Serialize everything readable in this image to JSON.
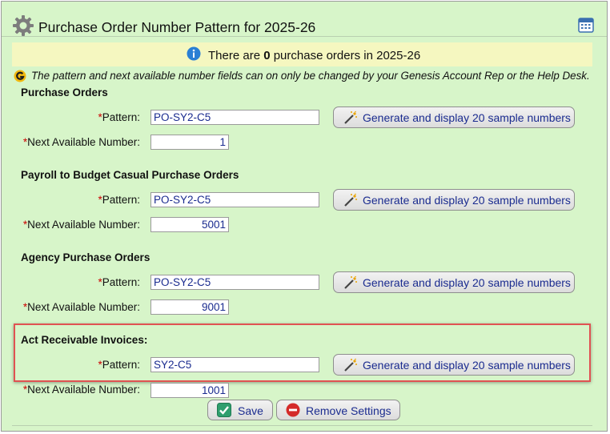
{
  "title": "Purchase Order Number Pattern for 2025-26",
  "banner": {
    "prefix": "There are ",
    "count": "0",
    "suffix": " purchase orders in 2025-26"
  },
  "notice": "The pattern and next available number fields can on only be changed by your Genesis Account Rep or the Help Desk.",
  "labels": {
    "required_mark": "*",
    "pattern": "Pattern:",
    "next_available": "Next Available Number:"
  },
  "generate_label": "Generate and display 20 sample numbers",
  "sections": [
    {
      "title": "Purchase Orders",
      "pattern": "PO-SY2-C5",
      "next": "1"
    },
    {
      "title": "Payroll to Budget Casual Purchase Orders",
      "pattern": "PO-SY2-C5",
      "next": "5001"
    },
    {
      "title": "Agency Purchase Orders",
      "pattern": "PO-SY2-C5",
      "next": "9001"
    },
    {
      "title": "Act Receivable Invoices:",
      "pattern": "SY2-C5",
      "next": "1001"
    }
  ],
  "actions": {
    "save": "Save",
    "remove": "Remove Settings"
  },
  "colors": {
    "panel_bg": "#d7f5c9",
    "banner_bg": "#f5f7c0",
    "highlight": "#e05252",
    "link_text": "#1a2b8f"
  },
  "icons": {
    "header": "gear-icon",
    "header_right": "calendar-icon",
    "banner": "info-icon",
    "notice": "genesis-g-icon",
    "generate": "magic-wand-icon",
    "save": "checkmark-icon",
    "remove": "remove-icon"
  }
}
